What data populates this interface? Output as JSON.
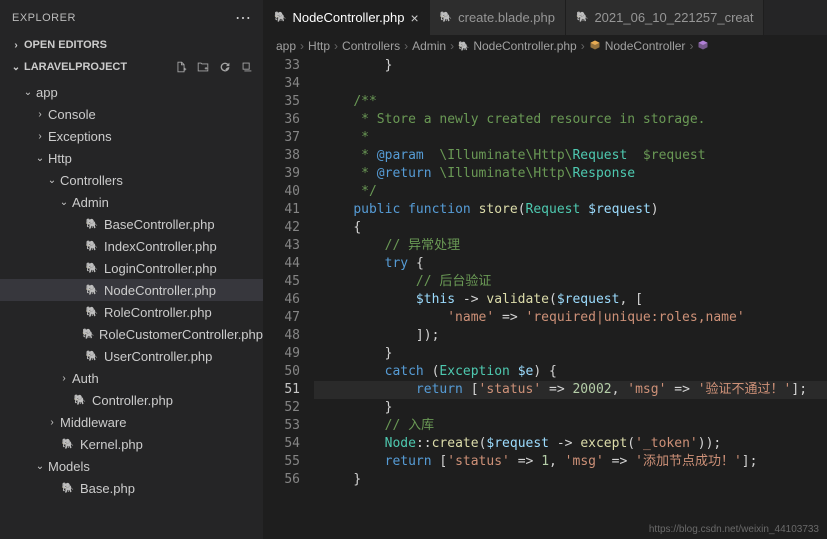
{
  "sidebar": {
    "title": "EXPLORER",
    "openEditors": "OPEN EDITORS",
    "projectName": "LARAVELPROJECT",
    "tree": [
      {
        "label": "app",
        "type": "folder",
        "depth": 1,
        "open": true
      },
      {
        "label": "Console",
        "type": "folder",
        "depth": 2,
        "open": false
      },
      {
        "label": "Exceptions",
        "type": "folder",
        "depth": 2,
        "open": false
      },
      {
        "label": "Http",
        "type": "folder",
        "depth": 2,
        "open": true
      },
      {
        "label": "Controllers",
        "type": "folder",
        "depth": 3,
        "open": true
      },
      {
        "label": "Admin",
        "type": "folder",
        "depth": 4,
        "open": true
      },
      {
        "label": "BaseController.php",
        "type": "file",
        "depth": 5
      },
      {
        "label": "IndexController.php",
        "type": "file",
        "depth": 5
      },
      {
        "label": "LoginController.php",
        "type": "file",
        "depth": 5
      },
      {
        "label": "NodeController.php",
        "type": "file",
        "depth": 5,
        "active": true
      },
      {
        "label": "RoleController.php",
        "type": "file",
        "depth": 5
      },
      {
        "label": "RoleCustomerController.php",
        "type": "file",
        "depth": 5
      },
      {
        "label": "UserController.php",
        "type": "file",
        "depth": 5
      },
      {
        "label": "Auth",
        "type": "folder",
        "depth": 4,
        "open": false
      },
      {
        "label": "Controller.php",
        "type": "file",
        "depth": 4
      },
      {
        "label": "Middleware",
        "type": "folder",
        "depth": 3,
        "open": false
      },
      {
        "label": "Kernel.php",
        "type": "file",
        "depth": 3
      },
      {
        "label": "Models",
        "type": "folder",
        "depth": 2,
        "open": true
      },
      {
        "label": "Base.php",
        "type": "file",
        "depth": 3
      }
    ]
  },
  "tabs": [
    {
      "label": "NodeController.php",
      "active": true,
      "closable": true
    },
    {
      "label": "create.blade.php",
      "active": false
    },
    {
      "label": "2021_06_10_221257_creat",
      "active": false
    }
  ],
  "breadcrumb": [
    "app",
    "Http",
    "Controllers",
    "Admin",
    "NodeController.php",
    "NodeController"
  ],
  "code": {
    "startLine": 33,
    "currentLine": 51,
    "lines": [
      {
        "n": 33,
        "html": "        <span class='c-pun'>}</span>"
      },
      {
        "n": 34,
        "html": ""
      },
      {
        "n": 35,
        "html": "    <span class='c-doc'>/**</span>"
      },
      {
        "n": 36,
        "html": "     <span class='c-doc'>* Store a newly created resource in storage.</span>"
      },
      {
        "n": 37,
        "html": "     <span class='c-doc'>*</span>"
      },
      {
        "n": 38,
        "html": "     <span class='c-doc'>* </span><span class='c-tag'>@param</span><span class='c-doc'>  \\Illuminate\\Http\\</span><span class='c-ns'>Request</span><span class='c-doc'>  $request</span>"
      },
      {
        "n": 39,
        "html": "     <span class='c-doc'>* </span><span class='c-tag'>@return</span><span class='c-doc'> \\Illuminate\\Http\\</span><span class='c-ns'>Response</span>"
      },
      {
        "n": 40,
        "html": "     <span class='c-doc'>*/</span>"
      },
      {
        "n": 41,
        "html": "    <span class='c-kw'>public</span> <span class='c-kw'>function</span> <span class='c-fn'>store</span><span class='c-pun'>(</span><span class='c-type'>Request</span> <span class='c-var'>$request</span><span class='c-pun'>)</span>"
      },
      {
        "n": 42,
        "html": "    <span class='c-pun'>{</span>"
      },
      {
        "n": 43,
        "html": "        <span class='c-com'>// 异常处理</span>"
      },
      {
        "n": 44,
        "html": "        <span class='c-kw'>try</span> <span class='c-pun'>{</span>"
      },
      {
        "n": 45,
        "html": "            <span class='c-com'>// 后台验证</span>"
      },
      {
        "n": 46,
        "html": "            <span class='c-var'>$this</span> <span class='c-op'>-></span> <span class='c-fn'>validate</span><span class='c-pun'>(</span><span class='c-var'>$request</span><span class='c-pun'>, [</span>"
      },
      {
        "n": 47,
        "html": "                <span class='c-str'>'name'</span> <span class='c-op'>=></span> <span class='c-str'>'required|unique:roles,name'</span>"
      },
      {
        "n": 48,
        "html": "            <span class='c-pun'>]);</span>"
      },
      {
        "n": 49,
        "html": "        <span class='c-pun'>}</span>"
      },
      {
        "n": 50,
        "html": "        <span class='c-kw'>catch</span> <span class='c-pun'>(</span><span class='c-type'>Exception</span> <span class='c-var'>$e</span><span class='c-pun'>) {</span>"
      },
      {
        "n": 51,
        "html": "            <span class='c-kw'>return</span> <span class='c-pun'>[</span><span class='c-str'>'status'</span> <span class='c-op'>=></span> <span class='c-num'>20002</span><span class='c-pun'>,</span> <span class='c-str'>'msg'</span> <span class='c-op'>=></span> <span class='c-str'>'验证不通过！'</span><span class='c-pun'>];</span>"
      },
      {
        "n": 52,
        "html": "        <span class='c-pun'>}</span>"
      },
      {
        "n": 53,
        "html": "        <span class='c-com'>// 入库</span>"
      },
      {
        "n": 54,
        "html": "        <span class='c-type'>Node</span><span class='c-op'>::</span><span class='c-fn'>create</span><span class='c-pun'>(</span><span class='c-var'>$request</span> <span class='c-op'>-></span> <span class='c-fn'>except</span><span class='c-pun'>(</span><span class='c-str'>'_token'</span><span class='c-pun'>));</span>"
      },
      {
        "n": 55,
        "html": "        <span class='c-kw'>return</span> <span class='c-pun'>[</span><span class='c-str'>'status'</span> <span class='c-op'>=></span> <span class='c-num'>1</span><span class='c-pun'>,</span> <span class='c-str'>'msg'</span> <span class='c-op'>=></span> <span class='c-str'>'添加节点成功！'</span><span class='c-pun'>];</span>"
      },
      {
        "n": 56,
        "html": "    <span class='c-pun'>}</span>"
      }
    ]
  },
  "watermark": "https://blog.csdn.net/weixin_44103733"
}
